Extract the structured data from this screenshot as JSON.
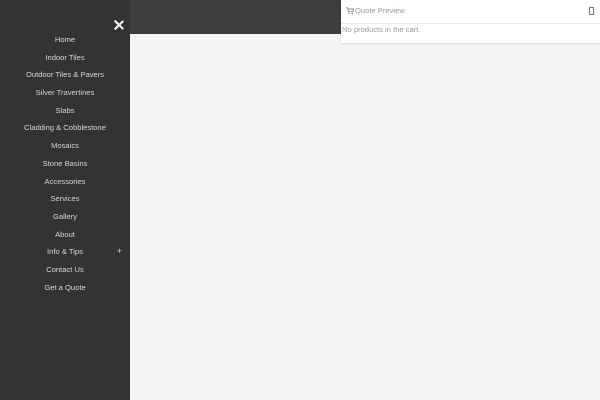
{
  "menu": {
    "items": [
      {
        "label": "Home"
      },
      {
        "label": "Indoor Tiles"
      },
      {
        "label": "Outdoor Tiles & Pavers"
      },
      {
        "label": "Silver Travertines"
      },
      {
        "label": "Slabs"
      },
      {
        "label": "Cladding & Cobblestone"
      },
      {
        "label": "Mosaics"
      },
      {
        "label": "Stone Basins"
      },
      {
        "label": "Accessories"
      },
      {
        "label": "Services"
      },
      {
        "label": "Gallery"
      },
      {
        "label": "About"
      },
      {
        "label": "Info & Tips",
        "expand": "+"
      },
      {
        "label": "Contact Us"
      },
      {
        "label": "Get a Quote"
      }
    ]
  },
  "quote_panel": {
    "title": "Quote Preview",
    "empty_message": "No products in the cart."
  },
  "colors": {
    "menu_bg": "#333333",
    "topbar_bg": "#3d3d3d",
    "page_bg": "#f5f5f5"
  },
  "icons": {
    "close": "close-icon",
    "cart": "cart-icon",
    "expand": "plus-icon",
    "panel_toggle": "panel-toggle-icon"
  }
}
